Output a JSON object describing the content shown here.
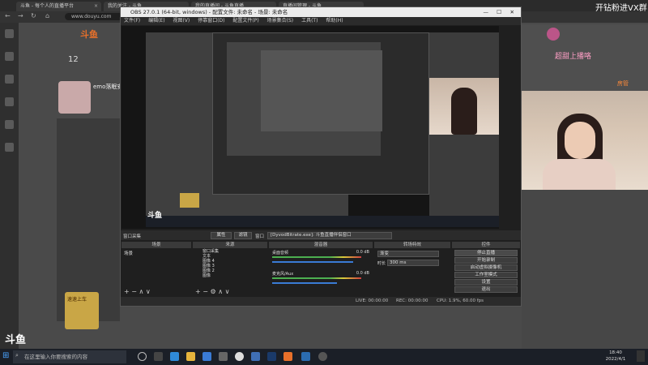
{
  "browser": {
    "tabs": [
      {
        "label": "斗鱼 - 每个人的直播平台"
      },
      {
        "label": "我的关注 - 斗鱼"
      },
      {
        "label": "我的直播间 - 斗鱼直播"
      },
      {
        "label": "直播间管理 - 斗鱼"
      }
    ],
    "url": "www.douyu.com"
  },
  "douyu": {
    "logo": "斗鱼",
    "follow_count": "12",
    "anchor_name": "emo落眠安",
    "overlay_text": "开钻粉进VX群",
    "sticker_text": "超甜上播咯",
    "house_label": "房管",
    "promo_label": "速速上车"
  },
  "obs": {
    "title": "OBS 27.0.1 (64-bit, windows) - 配置文件: 未命名 - 场景: 未命名",
    "menu": [
      "文件(F)",
      "编辑(E)",
      "视图(V)",
      "停靠窗口(D)",
      "配置文件(P)",
      "场景集合(S)",
      "工具(T)",
      "帮助(H)"
    ],
    "source_bar": {
      "no_source": "窗口采集",
      "properties": "属性",
      "filters": "滤镜",
      "window_label": "窗口",
      "window_value": "[DyvodBitrate.exe]: 斗鱼直播伴侣窗口"
    },
    "panels": {
      "scenes": "场景",
      "sources": "来源",
      "mixer": "混音器",
      "transitions": "转场特效",
      "controls": "控件"
    },
    "scene_items": [
      "场景"
    ],
    "source_items": [
      "窗口采集",
      "文本",
      "图像 4",
      "图像 3",
      "图像 2",
      "图像"
    ],
    "mixer": {
      "desktop_label": "桌面音频",
      "desktop_db": "0.0 dB",
      "mic_label": "麦克风/Aux",
      "mic_db": "0.0 dB"
    },
    "transition": {
      "type": "渐变",
      "duration_label": "时长",
      "duration_value": "300 ms"
    },
    "controls": [
      "停止直播",
      "开始录制",
      "启动虚拟摄像机",
      "工作室模式",
      "设置",
      "退出"
    ],
    "status": {
      "live": "LIVE: 00:00:00",
      "rec": "REC: 00:00:00",
      "cpu": "CPU: 1.9%, 60.00 fps"
    }
  },
  "taskbar": {
    "search_placeholder": "在这里输入你要搜索的内容",
    "time": "18:40",
    "date": "2022/4/1"
  }
}
